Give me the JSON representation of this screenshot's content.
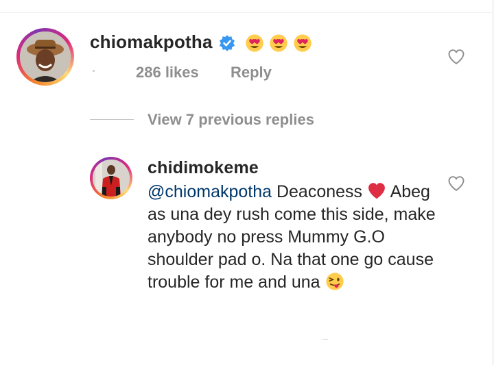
{
  "comment": {
    "username": "chiomakpotha",
    "verified": true,
    "text_emojis": [
      "heart-eyes",
      "heart-eyes",
      "heart-eyes"
    ],
    "likes": "286 likes",
    "reply_label": "Reply"
  },
  "view_previous_replies": "View 7 previous replies",
  "reply": {
    "username": "chidimokeme",
    "mention": "@chiomakpotha",
    "text": " Deaconess ",
    "text_after_heart": " Abeg as una dey rush come this side, make anybody no press Mummy G.O shoulder pad o. Na that one go cause trouble for me and una ",
    "emojis": [
      "red-heart",
      "winking-tongue-face"
    ]
  },
  "colors": {
    "text": "#262626",
    "muted": "#8e8e8e",
    "mention": "#00376b",
    "verified_blue": "#3897f0"
  }
}
